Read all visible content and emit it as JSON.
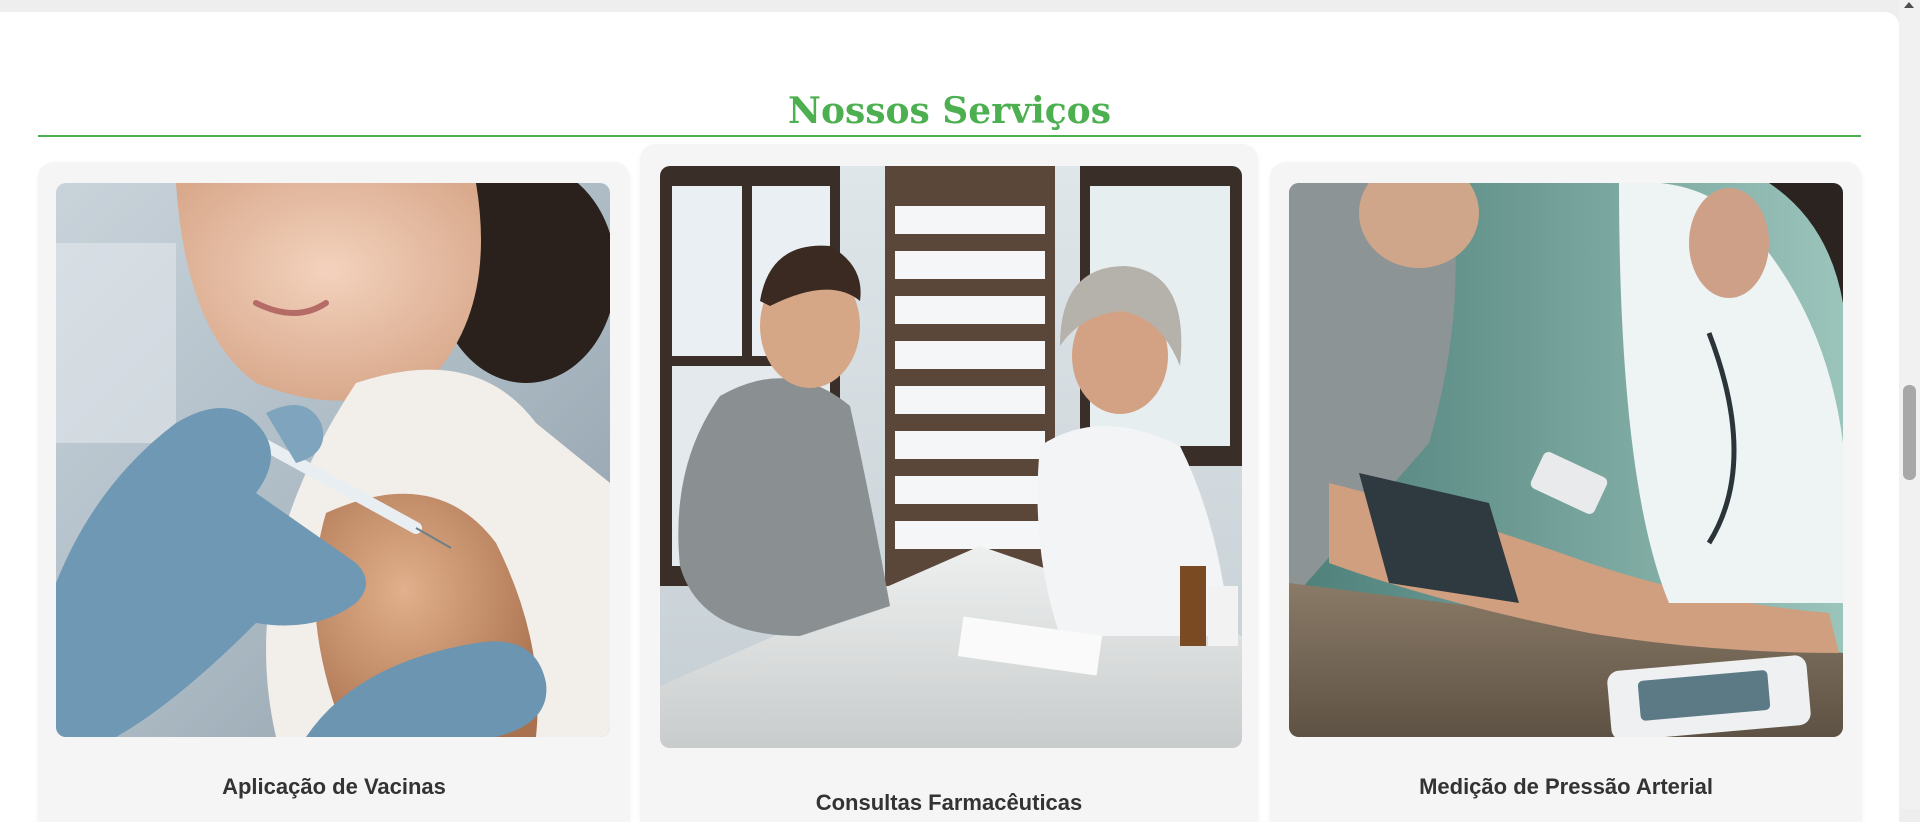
{
  "section": {
    "title": "Nossos Serviços",
    "accent_color": "#4caf50"
  },
  "services": [
    {
      "title": "Aplicação de Vacinas",
      "image": "vaccine-application-photo"
    },
    {
      "title": "Consultas Farmacêuticas",
      "image": "pharmacist-consultation-photo"
    },
    {
      "title": "Medição de Pressão Arterial",
      "image": "blood-pressure-measurement-photo"
    }
  ]
}
